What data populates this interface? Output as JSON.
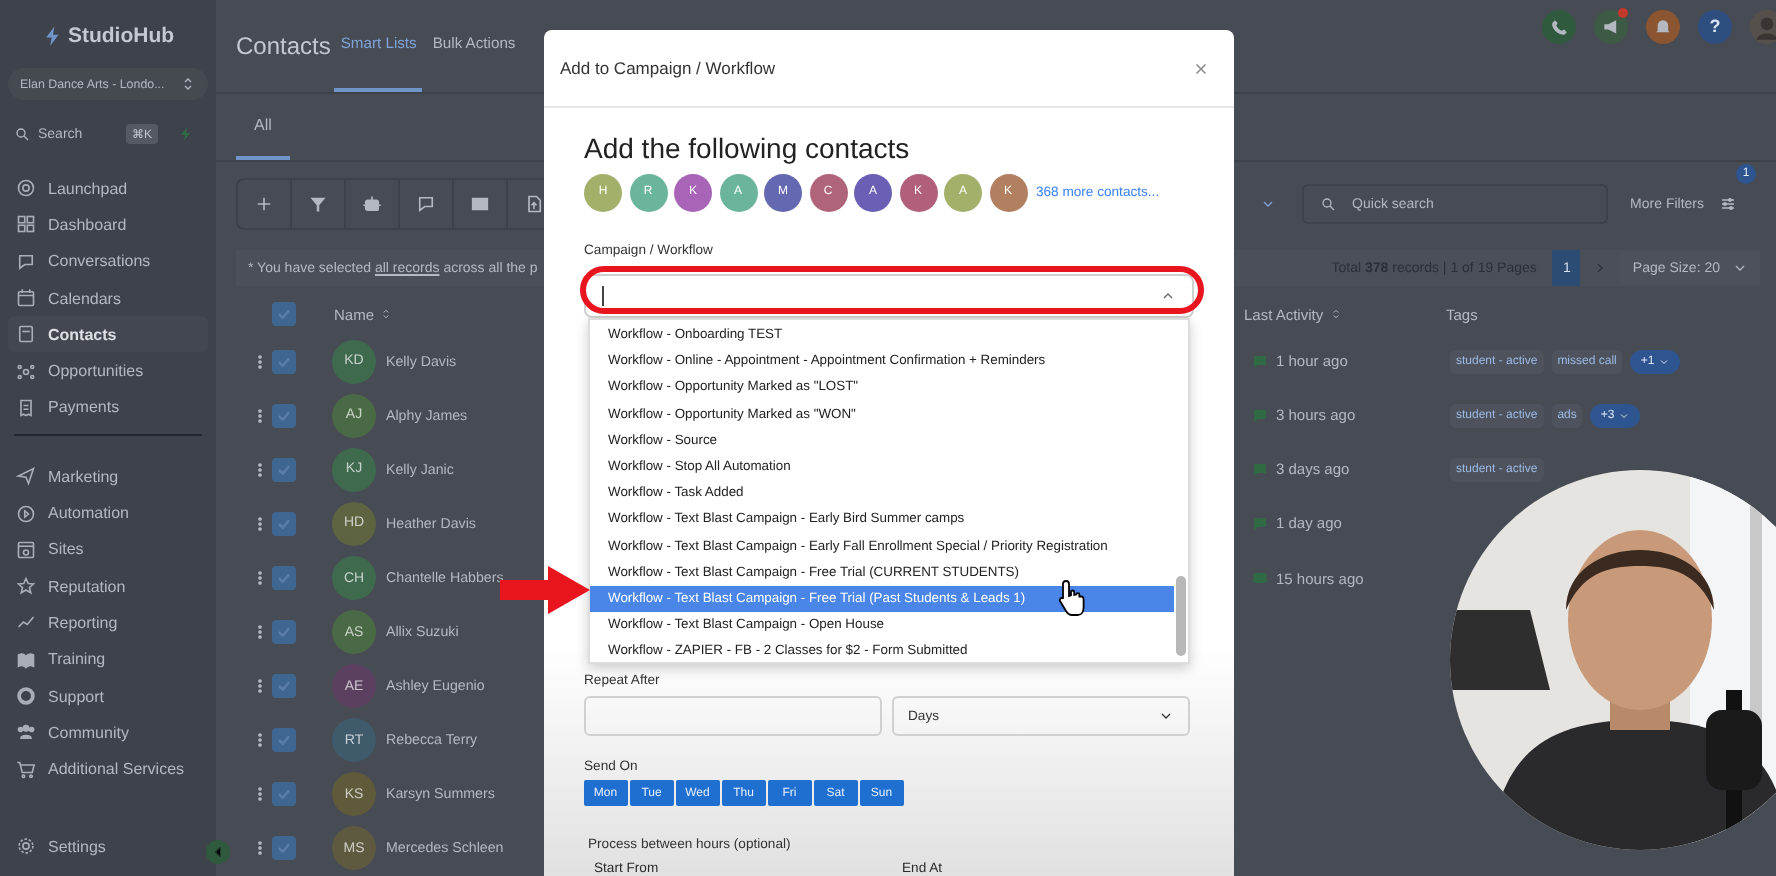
{
  "sidebar": {
    "logo": "StudioHub",
    "location": "Elan Dance Arts - Londo...",
    "search": {
      "placeholder": "Search",
      "shortcut": "⌘K"
    },
    "sections": [
      {
        "items": [
          {
            "label": "Launchpad",
            "selected": false
          },
          {
            "label": "Dashboard",
            "selected": false
          },
          {
            "label": "Conversations",
            "selected": false
          },
          {
            "label": "Calendars",
            "selected": false
          },
          {
            "label": "Contacts",
            "selected": true
          },
          {
            "label": "Opportunities",
            "selected": false
          },
          {
            "label": "Payments",
            "selected": false
          }
        ]
      },
      {
        "items": [
          {
            "label": "Marketing",
            "selected": false
          },
          {
            "label": "Automation",
            "selected": false
          },
          {
            "label": "Sites",
            "selected": false
          },
          {
            "label": "Reputation",
            "selected": false
          },
          {
            "label": "Reporting",
            "selected": false
          },
          {
            "label": "Training",
            "selected": false
          },
          {
            "label": "Support",
            "selected": false
          },
          {
            "label": "Community",
            "selected": false
          },
          {
            "label": "Additional Services",
            "selected": false
          }
        ]
      }
    ],
    "settings": "Settings"
  },
  "header": {
    "title": "Contacts",
    "tabs": [
      {
        "label": "Smart Lists",
        "selected": true
      },
      {
        "label": "Bulk Actions",
        "selected": false
      }
    ],
    "top_actions": {
      "help": "?",
      "unread_announcements": true
    }
  },
  "subtabs": [
    {
      "label": "All",
      "selected": true
    }
  ],
  "toolbar": {
    "search": {
      "placeholder": "Quick search"
    },
    "filters_button": {
      "label": "More Filters",
      "badge": "1"
    }
  },
  "selection_notice": {
    "before": "* You have selected ",
    "link": "all records",
    "after": " across all the p"
  },
  "pagination": {
    "summary": "Total **378** records | 1 of 19 Pages",
    "pages": [
      {
        "label": "1",
        "selected": true
      }
    ],
    "page_size": "Page Size: 20"
  },
  "table": {
    "columns": [
      "Name",
      "Last Activity",
      "Tags"
    ],
    "all_checked": true,
    "rows": [
      {
        "initials": "KD",
        "name": "Kelly Davis",
        "color": "#3f6a4d",
        "checked": true,
        "activity": {
          "kind": "message",
          "text": "1 hour ago"
        },
        "tags": [
          {
            "label": "student - active",
            "kind": "tag"
          },
          {
            "label": "missed call",
            "kind": "tag"
          },
          {
            "label": "+1",
            "kind": "more"
          }
        ]
      },
      {
        "initials": "AJ",
        "name": "Alphy James",
        "color": "#4a6a45",
        "checked": true,
        "activity": {
          "kind": "message",
          "text": "3 hours ago"
        },
        "tags": [
          {
            "label": "student - active",
            "kind": "tag"
          },
          {
            "label": "ads",
            "kind": "tag"
          },
          {
            "label": "+3",
            "kind": "more"
          }
        ]
      },
      {
        "initials": "KJ",
        "name": "Kelly Janic",
        "color": "#3f6a4d",
        "checked": true,
        "activity": {
          "kind": "message",
          "text": "3 days ago"
        },
        "tags": [
          {
            "label": "student - active",
            "kind": "tag"
          }
        ]
      },
      {
        "initials": "HD",
        "name": "Heather Davis",
        "color": "#5e6340",
        "checked": true,
        "activity": {
          "kind": "message",
          "text": "1 day ago"
        }
      },
      {
        "initials": "CH",
        "name": "Chantelle Habbers",
        "color": "#3f6a4d",
        "checked": true,
        "activity": {
          "kind": "email",
          "text": "15 hours ago"
        }
      },
      {
        "initials": "AS",
        "name": "Allix Suzuki",
        "color": "#4a6a45",
        "checked": true
      },
      {
        "initials": "AE",
        "name": "Ashley Eugenio",
        "color": "#5a3f5e",
        "checked": true
      },
      {
        "initials": "RT",
        "name": "Rebecca Terry",
        "color": "#3f5a6a",
        "checked": true
      },
      {
        "initials": "KS",
        "name": "Karsyn Summers",
        "color": "#5e5a3a",
        "checked": true
      },
      {
        "initials": "MS",
        "name": "Mercedes Schleen",
        "color": "#5e5a40",
        "checked": true
      }
    ]
  },
  "modal": {
    "title": "Add to Campaign / Workflow",
    "heading": "Add the following contacts",
    "contacts": [
      {
        "initial": "H",
        "color": "#a3b06a"
      },
      {
        "initial": "R",
        "color": "#6bb59d"
      },
      {
        "initial": "K",
        "color": "#a865b8"
      },
      {
        "initial": "A",
        "color": "#6bb59d"
      },
      {
        "initial": "M",
        "color": "#6468b0"
      },
      {
        "initial": "C",
        "color": "#b0647a"
      },
      {
        "initial": "A",
        "color": "#6a5fb5"
      },
      {
        "initial": "K",
        "color": "#b0607a"
      },
      {
        "initial": "A",
        "color": "#a3b06a"
      },
      {
        "initial": "K",
        "color": "#b08060"
      }
    ],
    "more_link": "368 more contacts...",
    "campaign_field": {
      "label": "Campaign / Workflow",
      "expanded": true,
      "options": [
        {
          "label": "Workflow - Onboarding TEST",
          "selected": false
        },
        {
          "label": "Workflow - Online - Appointment - Appointment Confirmation + Reminders",
          "selected": false
        },
        {
          "label": "Workflow - Opportunity Marked as \"LOST\"",
          "selected": false
        },
        {
          "label": "Workflow - Opportunity Marked as \"WON\"",
          "selected": false
        },
        {
          "label": "Workflow - Source",
          "selected": false
        },
        {
          "label": "Workflow - Stop All Automation",
          "selected": false
        },
        {
          "label": "Workflow - Task Added",
          "selected": false
        },
        {
          "label": "Workflow - Text Blast Campaign - Early Bird Summer camps",
          "selected": false
        },
        {
          "label": "Workflow - Text Blast Campaign - Early Fall Enrollment Special / Priority Registration",
          "selected": false
        },
        {
          "label": "Workflow - Text Blast Campaign - Free Trial (CURRENT STUDENTS)",
          "selected": false
        },
        {
          "label": "Workflow - Text Blast Campaign - Free Trial (Past Students & Leads 1)",
          "selected": true
        },
        {
          "label": "Workflow - Text Blast Campaign - Open House",
          "selected": false
        },
        {
          "label": "Workflow - ZAPIER - FB - 2 Classes for $2 - Form Submitted",
          "selected": false
        }
      ]
    },
    "repeat_after": {
      "label": "Repeat After",
      "unit": "Days"
    },
    "send_on": {
      "label": "Send On",
      "days": [
        {
          "label": "Mon",
          "selected": true
        },
        {
          "label": "Tue",
          "selected": true
        },
        {
          "label": "Wed",
          "selected": true
        },
        {
          "label": "Thu",
          "selected": true
        },
        {
          "label": "Fri",
          "selected": true
        },
        {
          "label": "Sat",
          "selected": true
        },
        {
          "label": "Sun",
          "selected": true
        }
      ]
    },
    "hours": {
      "label": "Process between hours (optional)",
      "start_label": "Start From",
      "end_label": "End At"
    }
  }
}
